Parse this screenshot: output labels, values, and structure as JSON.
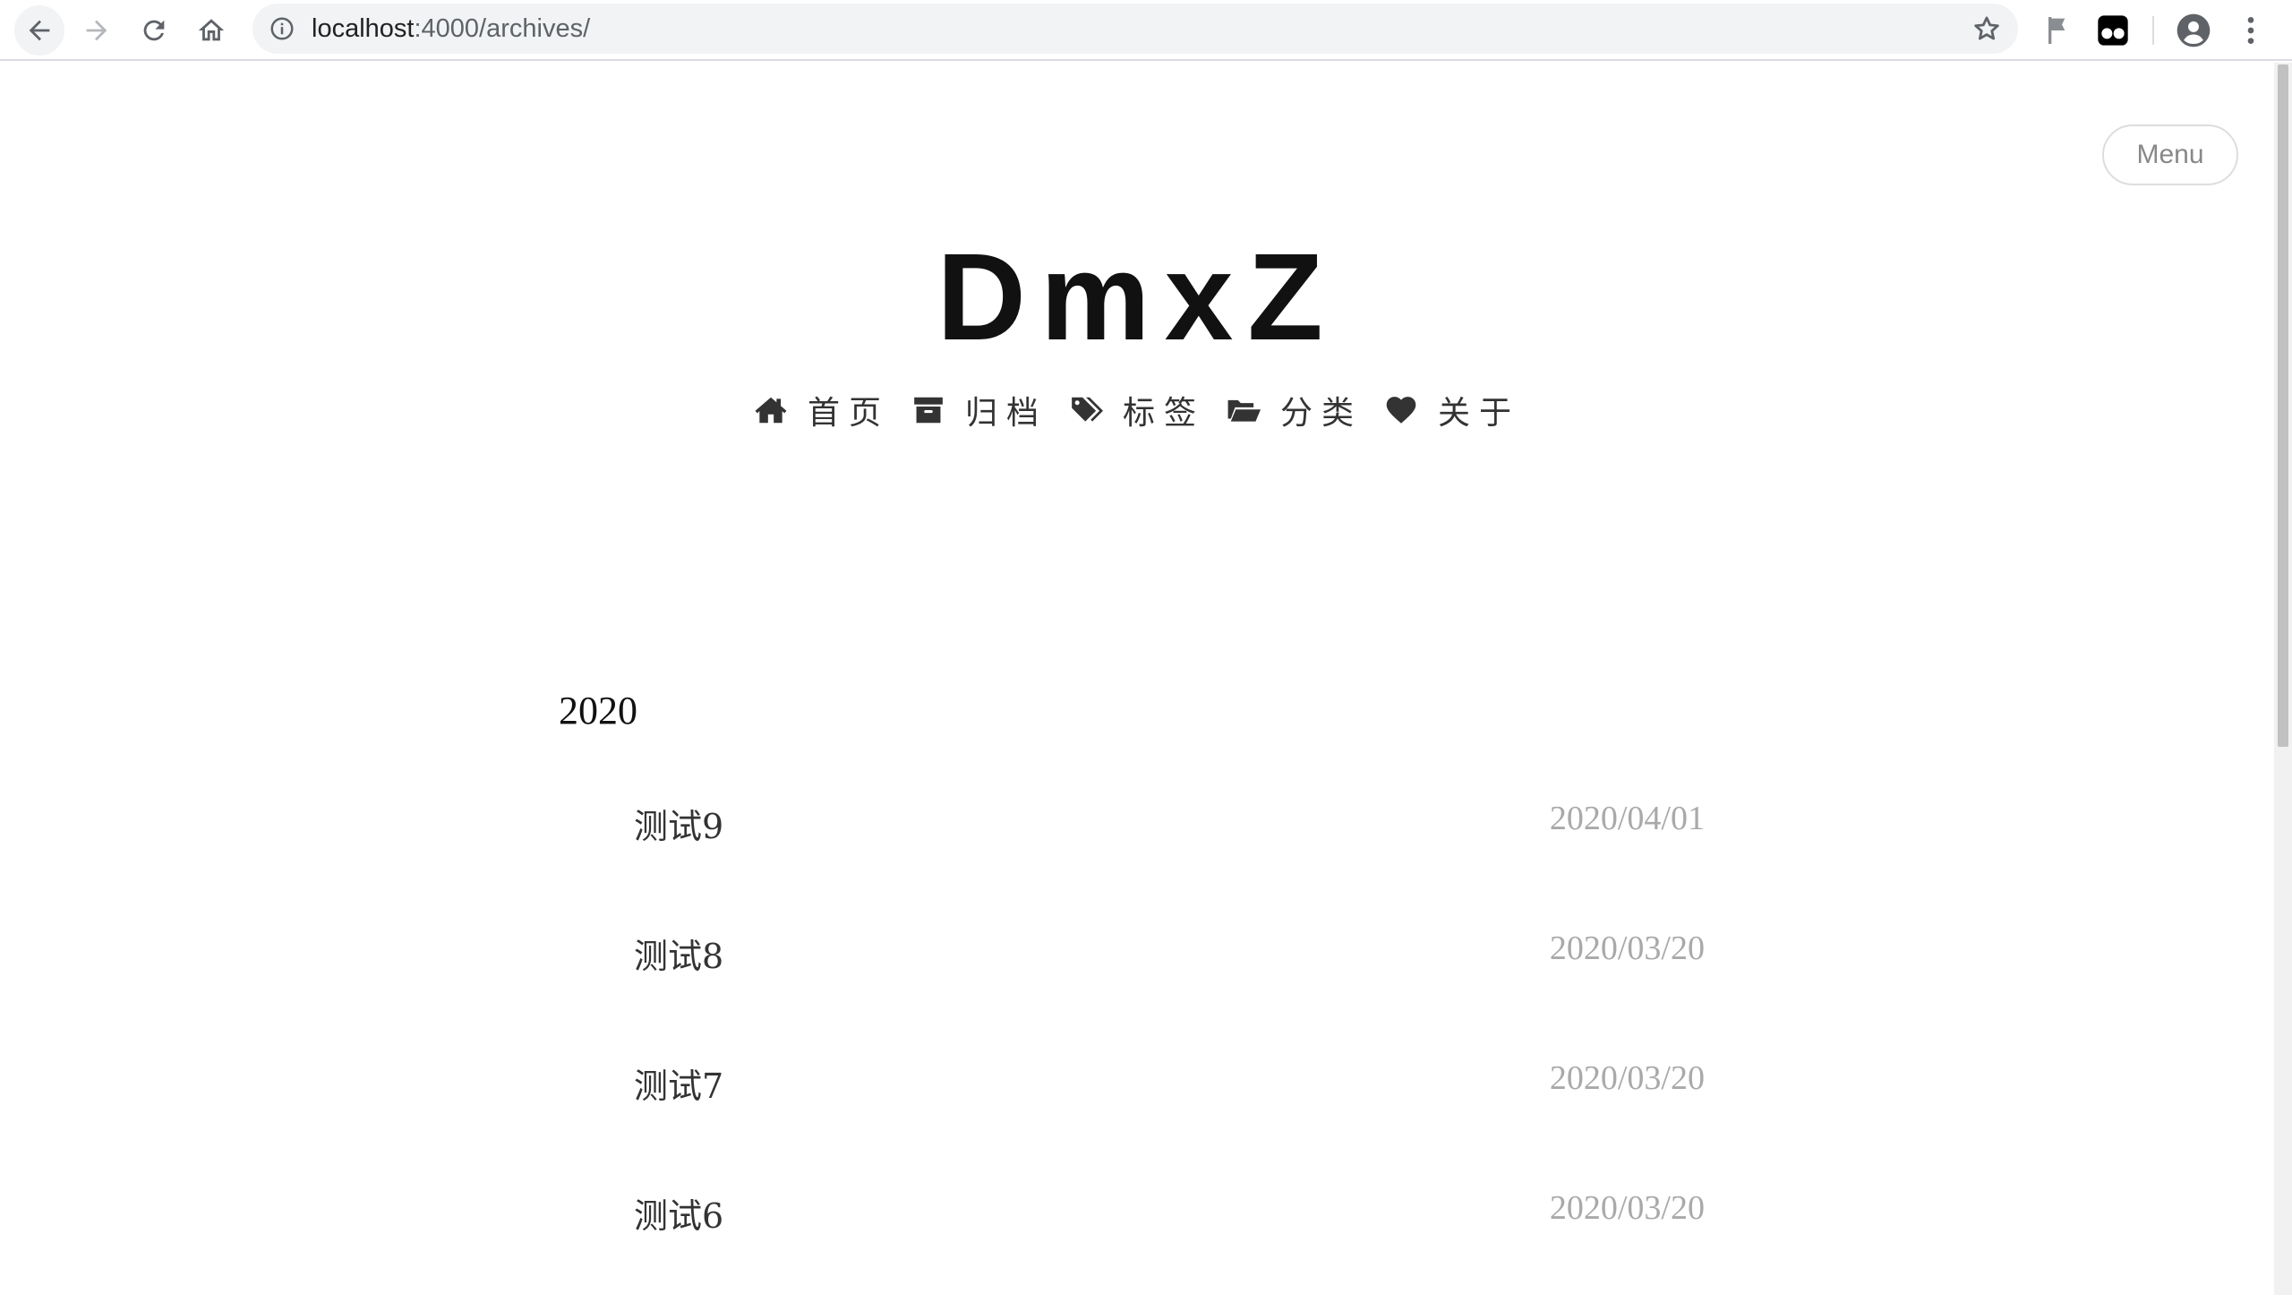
{
  "browser": {
    "url_host": "localhost",
    "url_path": ":4000/archives/"
  },
  "menu_label": "Menu",
  "site_title": "DmxZ",
  "nav": [
    {
      "icon": "home-icon",
      "label": "首页"
    },
    {
      "icon": "archive-icon",
      "label": "归档"
    },
    {
      "icon": "tags-icon",
      "label": "标签"
    },
    {
      "icon": "folder-open-icon",
      "label": "分类"
    },
    {
      "icon": "heart-icon",
      "label": "关于"
    }
  ],
  "archive": {
    "year": "2020",
    "posts": [
      {
        "title": "测试9",
        "date": "2020/04/01"
      },
      {
        "title": "测试8",
        "date": "2020/03/20"
      },
      {
        "title": "测试7",
        "date": "2020/03/20"
      },
      {
        "title": "测试6",
        "date": "2020/03/20"
      }
    ]
  }
}
